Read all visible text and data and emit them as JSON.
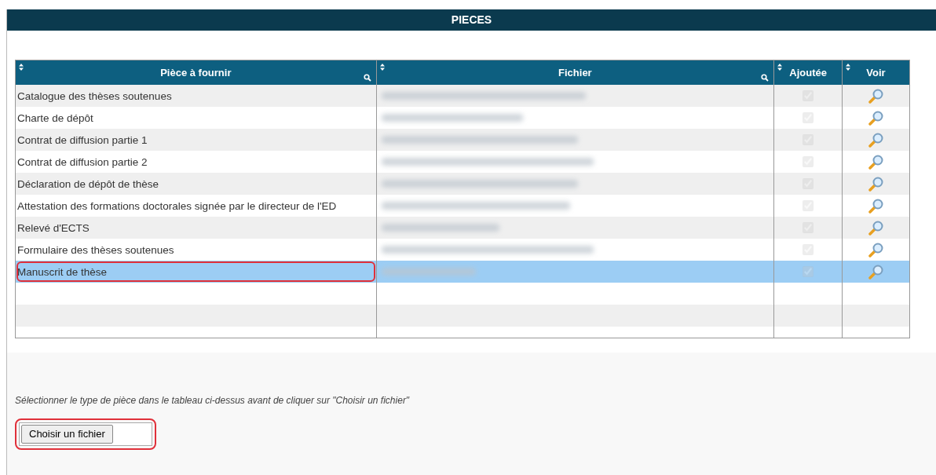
{
  "panel": {
    "title": "PIECES"
  },
  "table": {
    "columns": [
      {
        "label": "Pièce à fournir",
        "searchable": true
      },
      {
        "label": "Fichier",
        "searchable": true
      },
      {
        "label": "Ajoutée",
        "searchable": false
      },
      {
        "label": "Voir",
        "searchable": false
      }
    ],
    "rows": [
      {
        "piece": "Catalogue des thèses soutenues",
        "added": true,
        "selected": false,
        "annotated": false
      },
      {
        "piece": "Charte de dépôt",
        "added": true,
        "selected": false,
        "annotated": false
      },
      {
        "piece": "Contrat de diffusion partie 1",
        "added": true,
        "selected": false,
        "annotated": false
      },
      {
        "piece": "Contrat de diffusion partie 2",
        "added": true,
        "selected": false,
        "annotated": false
      },
      {
        "piece": "Déclaration de dépôt de thèse",
        "added": true,
        "selected": false,
        "annotated": false
      },
      {
        "piece": "Attestation des formations doctorales signée par le directeur de l'ED",
        "added": true,
        "selected": false,
        "annotated": false
      },
      {
        "piece": "Relevé d'ECTS",
        "added": true,
        "selected": false,
        "annotated": false
      },
      {
        "piece": "Formulaire des thèses soutenues",
        "added": true,
        "selected": false,
        "annotated": false
      },
      {
        "piece": "Manuscrit de thèse",
        "added": true,
        "selected": true,
        "annotated": true
      }
    ]
  },
  "hint": "Sélectionner le type de pièce dans le tableau ci-dessus avant de cliquer sur \"Choisir un fichier\"",
  "file_input": {
    "button": "Choisir un fichier",
    "annotated": true
  }
}
